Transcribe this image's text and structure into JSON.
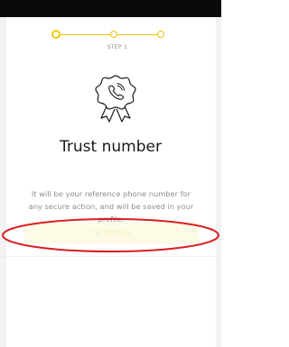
{
  "stepper": {
    "step_label": "STEP 1",
    "accent_color": "#f0cc00"
  },
  "badge": {
    "icon": "phone-in-ribbon-badge-icon"
  },
  "title": "Trust number",
  "description": "It will be your reference phone number for any secure action, and will be saved in your profile.",
  "define_button": {
    "label": "TO DEFINE"
  },
  "annotation": {
    "shape": "ellipse",
    "color": "#d81e1e"
  }
}
